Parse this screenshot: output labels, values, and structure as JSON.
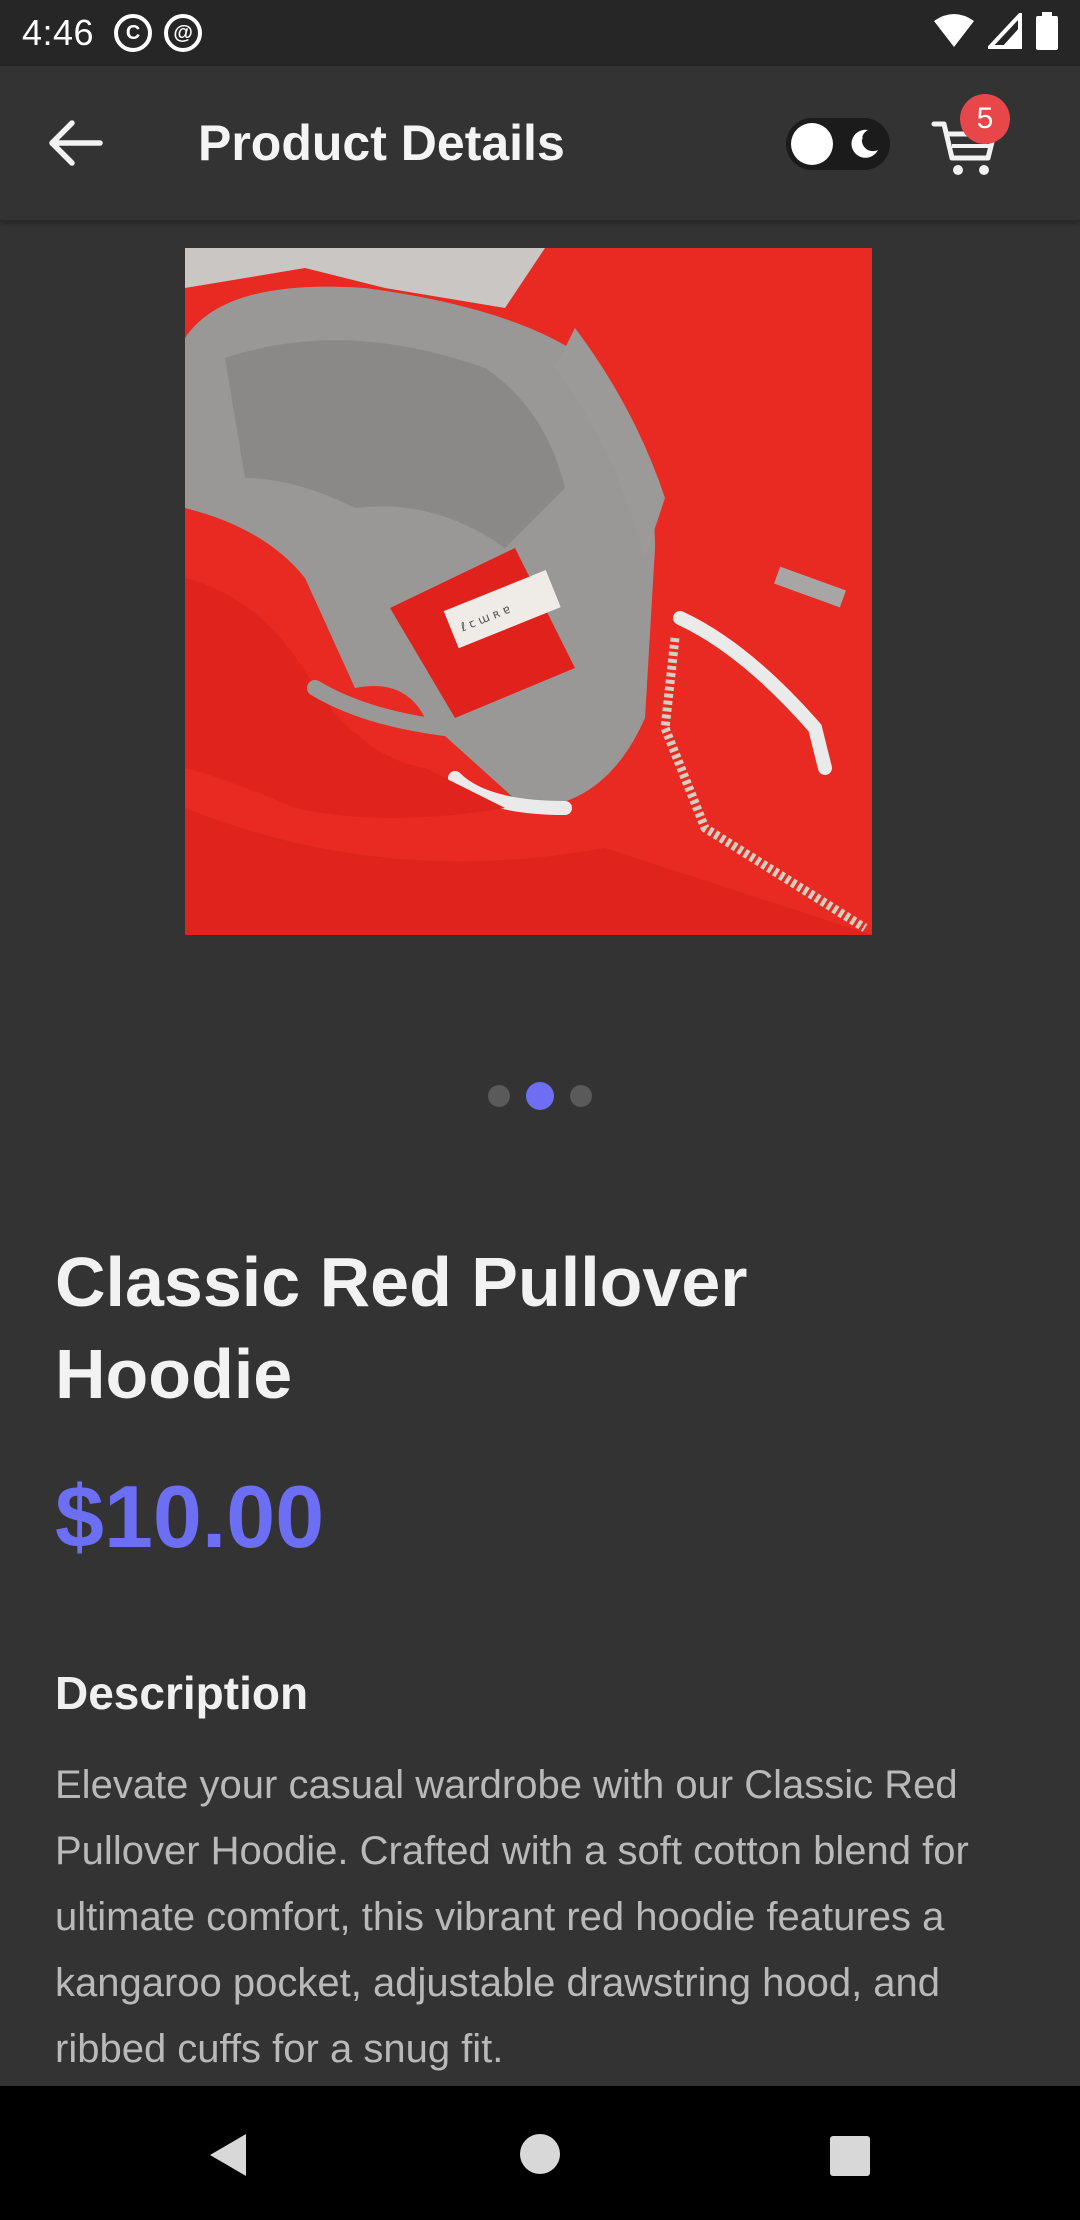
{
  "status_bar": {
    "time": "4:46",
    "icons": [
      "notification-c-icon",
      "notification-at-icon",
      "wifi-icon",
      "signal-icon",
      "battery-icon"
    ]
  },
  "app_bar": {
    "title": "Product Details",
    "cart_count": "5",
    "theme_toggle": "dark-mode",
    "accent": "#6c6ef4",
    "badge_color": "#e8474a"
  },
  "gallery": {
    "image_alt": "Red hoodie",
    "page_count": 3,
    "active_index": 1
  },
  "product": {
    "name": "Classic Red Pullover Hoodie",
    "price": "$10.00",
    "description_heading": "Description",
    "description": "Elevate your casual wardrobe with our Classic Red Pullover Hoodie. Crafted with a soft cotton blend for ultimate comfort, this vibrant red hoodie features a kangaroo pocket, adjustable drawstring hood, and ribbed cuffs for a snug fit."
  }
}
